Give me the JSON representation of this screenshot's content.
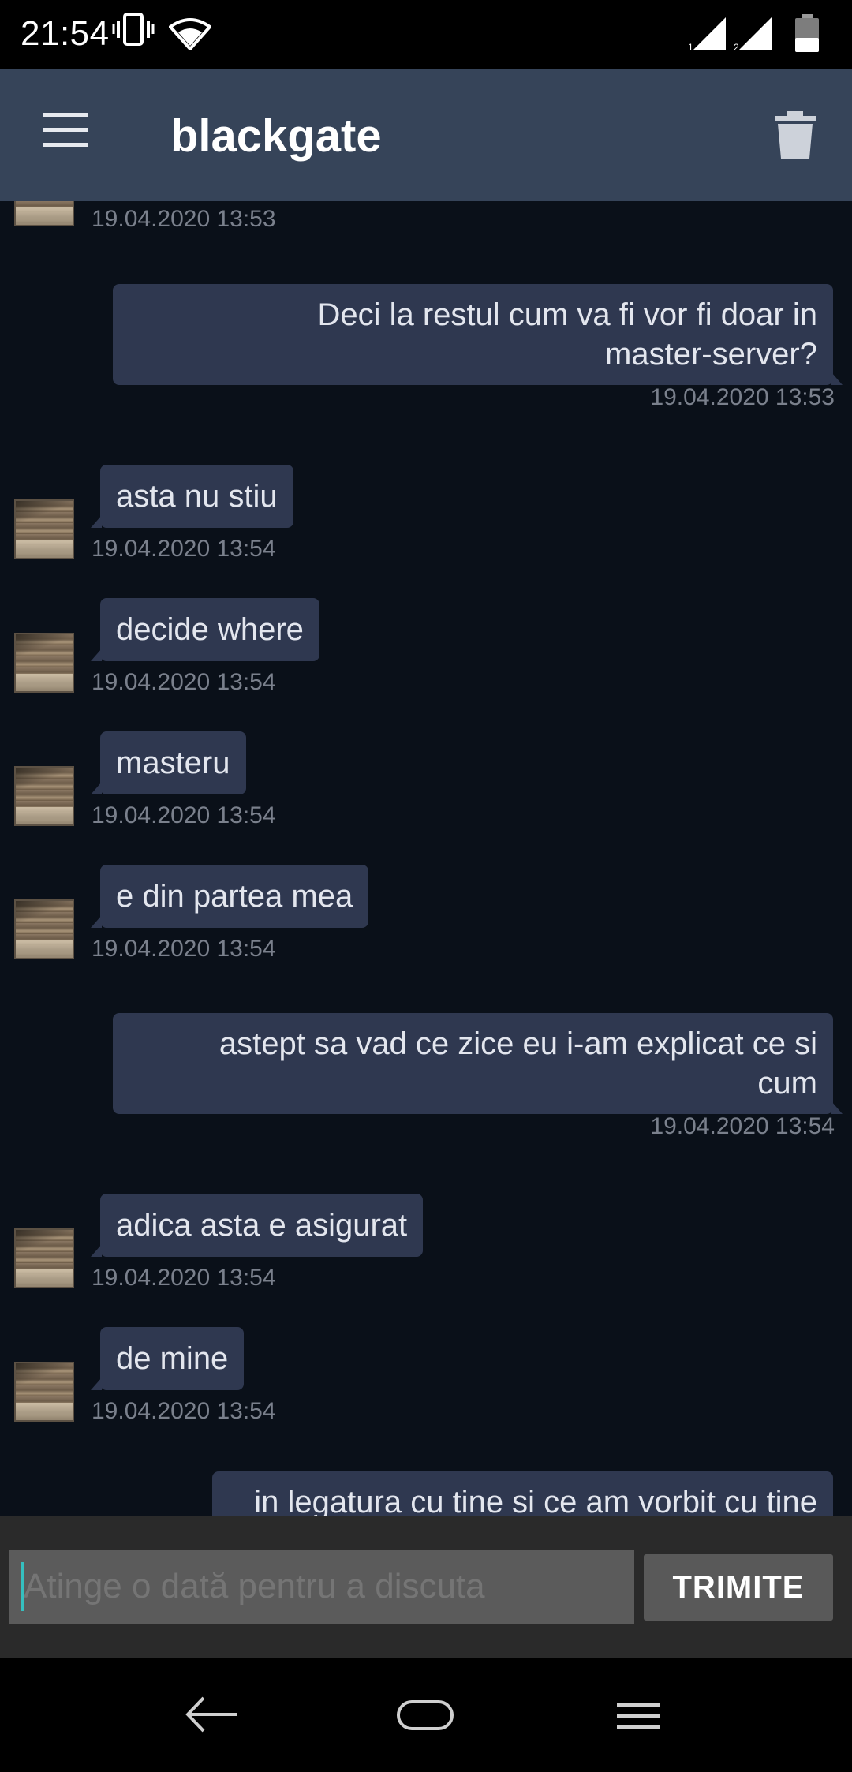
{
  "status_bar": {
    "time": "21:54",
    "icons": [
      "vibrate-icon",
      "wifi-icon",
      "signal-sim1-icon",
      "signal-sim2-icon",
      "battery-icon"
    ],
    "sim1_label": "1",
    "sim2_label": "2"
  },
  "app_bar": {
    "title": "blackgate",
    "menu_icon": "hamburger-menu-icon",
    "delete_icon": "trash-icon",
    "background": "#364459"
  },
  "messages": [
    {
      "direction": "in",
      "text": "",
      "time": "19.04.2020 13:53"
    },
    {
      "direction": "out",
      "lines": [
        "Deci la restul cum va fi vor fi doar in",
        "master-server?"
      ],
      "time": "19.04.2020 13:53"
    },
    {
      "direction": "in",
      "text": "asta nu stiu",
      "time": "19.04.2020 13:54"
    },
    {
      "direction": "in",
      "text": "decide where",
      "time": "19.04.2020 13:54"
    },
    {
      "direction": "in",
      "text": "masteru",
      "time": "19.04.2020 13:54"
    },
    {
      "direction": "in",
      "text": "e din partea mea",
      "time": "19.04.2020 13:54"
    },
    {
      "direction": "out",
      "lines": [
        "astept sa vad ce zice eu i-am explicat ce si",
        "cum"
      ],
      "time": "19.04.2020 13:54"
    },
    {
      "direction": "in",
      "text": "adica asta e asigurat",
      "time": "19.04.2020 13:54"
    },
    {
      "direction": "in",
      "text": "de mine",
      "time": "19.04.2020 13:54"
    },
    {
      "direction": "out",
      "lines": [
        "in legatura cu tine si ce am vorbit cu tine"
      ],
      "time": ""
    }
  ],
  "composer": {
    "placeholder": "Atinge o dată pentru a discuta",
    "send_label": "TRIMITE"
  },
  "nav_bar": {
    "icons": [
      "back-icon",
      "home-icon",
      "recents-icon"
    ]
  },
  "colors": {
    "background": "#0a1019",
    "bubble": "#2f3850",
    "timestamp": "#7a808c",
    "accent_cursor": "#35c0c0"
  }
}
